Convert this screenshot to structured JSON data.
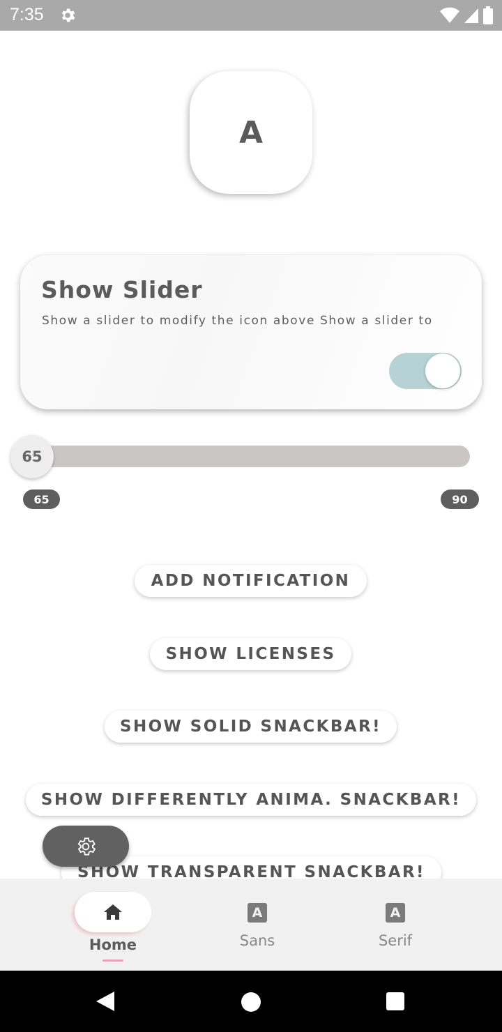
{
  "status_bar": {
    "time": "7:35",
    "icons": [
      "settings-gear-icon",
      "wifi-icon",
      "signal-icon",
      "battery-icon"
    ],
    "background": "#a9a9a9"
  },
  "avatar": {
    "letter": "A"
  },
  "card": {
    "title": "Show Slider",
    "description": "Show a slider to modify the icon above Show a slider to",
    "toggle_on": true,
    "toggle_color": "#b7d2d4"
  },
  "slider": {
    "value": "65",
    "min_label": "65",
    "max_label": "90",
    "min": 65,
    "max": 90,
    "current": 65
  },
  "buttons": {
    "add_notification": "ADD NOTIFICATION",
    "show_licenses": "SHOW LICENSES",
    "show_solid_snackbar": "SHOW SOLID SNACKBAR!",
    "show_anim_snackbar": "SHOW DIFFERENTLY ANIMA. SNACKBAR!",
    "show_transparent_snackbar": "SHOW TRANSPARENT SNACKBAR!"
  },
  "fab": {
    "icon": "settings-gear-icon"
  },
  "bottom_nav": {
    "items": [
      {
        "label": "Home",
        "icon": "home-icon",
        "active": true
      },
      {
        "label": "Sans",
        "icon": "font-a-icon",
        "active": false
      },
      {
        "label": "Serif",
        "icon": "font-a-icon",
        "active": false
      }
    ],
    "icon_letter": "A"
  },
  "system_nav": {
    "icons": [
      "back-icon",
      "home-circle-icon",
      "recents-icon"
    ]
  }
}
